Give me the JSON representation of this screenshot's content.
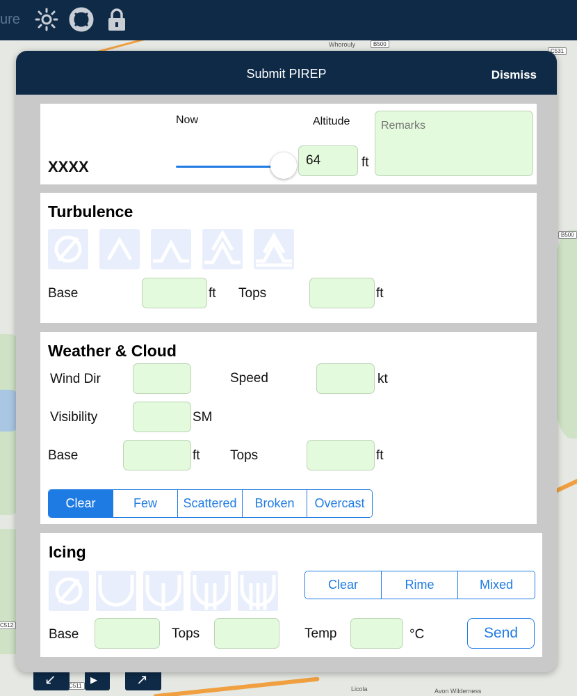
{
  "topbar": {
    "cut_label": "ure",
    "icons": [
      "brightness-icon",
      "lifebuoy-icon",
      "lock-icon"
    ]
  },
  "map_labels": {
    "whorouly": "Whorouly",
    "licola": "Licola",
    "avon": "Avon Wilderness",
    "b500a": "B500",
    "b500b": "B500",
    "c531": "C531",
    "c512": "C512",
    "c511": "C511"
  },
  "modal": {
    "title": "Submit PIREP",
    "dismiss_label": "Dismiss"
  },
  "report": {
    "aircraft": "XXXX",
    "time_label": "Now",
    "time_slider_fraction": 0.88,
    "altitude_label": "Altitude",
    "altitude_value": "64",
    "altitude_unit": "ft",
    "remarks_placeholder": "Remarks"
  },
  "turbulence": {
    "title": "Turbulence",
    "intensity_icons": [
      "none-icon",
      "turbulence-light-icon",
      "turbulence-moderate-icon",
      "turbulence-severe-icon",
      "turbulence-extreme-icon"
    ],
    "base_label": "Base",
    "base_unit": "ft",
    "tops_label": "Tops",
    "tops_unit": "ft"
  },
  "weather": {
    "title": "Weather & Cloud",
    "wind_dir_label": "Wind Dir",
    "speed_label": "Speed",
    "speed_unit": "kt",
    "visibility_label": "Visibility",
    "visibility_unit": "SM",
    "base_label": "Base",
    "base_unit": "ft",
    "tops_label": "Tops",
    "tops_unit": "ft",
    "cover_options": [
      "Clear",
      "Few",
      "Scattered",
      "Broken",
      "Overcast"
    ],
    "cover_selected": "Clear"
  },
  "icing": {
    "title": "Icing",
    "intensity_icons": [
      "none-icon",
      "icing-trace-icon",
      "icing-light-icon",
      "icing-moderate-icon",
      "icing-severe-icon"
    ],
    "type_options": [
      "Clear",
      "Rime",
      "Mixed"
    ],
    "base_label": "Base",
    "tops_label": "Tops",
    "temp_label": "Temp",
    "temp_unit": "°C",
    "send_label": "Send"
  },
  "colors": {
    "navy": "#0e2a47",
    "accent": "#1f7be4",
    "field_bg": "#e4fadd",
    "icon_bg": "#e8eefb"
  }
}
